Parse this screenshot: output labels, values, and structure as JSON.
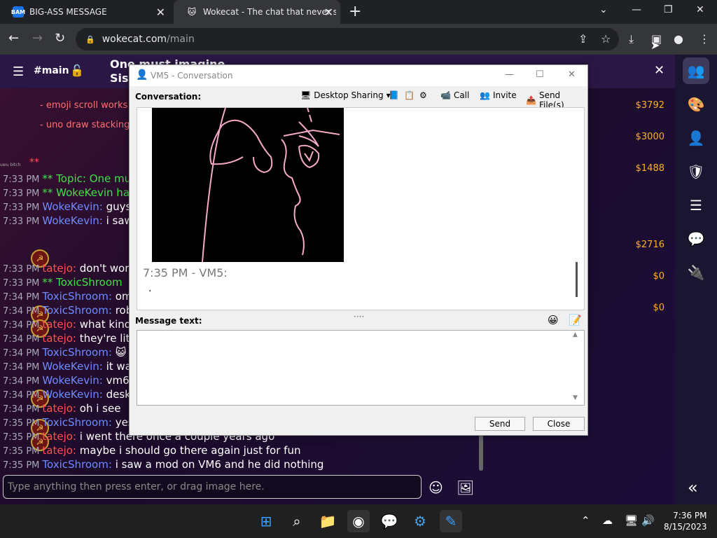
{
  "tabs": [
    {
      "label": "BIG-ASS MESSAGE",
      "icon": "BAM"
    },
    {
      "label": "Wokecat - The chat that never sle",
      "icon": "cat-icon"
    }
  ],
  "address": {
    "domain": "wokecat.com",
    "path": "/main"
  },
  "chat": {
    "channel": "#main",
    "topic": "One must imagine Sisyphus hap",
    "notes": [
      "- emoji scroll works r",
      "- uno draw stacking"
    ],
    "small_label": "uwu bitch",
    "stars": "**",
    "money": [
      "$3792",
      "$3000",
      "$1488",
      "$2716",
      "$0",
      "$0"
    ],
    "messages": [
      {
        "time": "7:33 PM",
        "user": "",
        "text": "** Topic: One mu",
        "style": "green"
      },
      {
        "time": "7:33 PM",
        "user": "",
        "text": "** WokeKevin ha",
        "style": "green"
      },
      {
        "time": "7:33 PM",
        "user": "WokeKevin:",
        "text": "guys",
        "style": "blue"
      },
      {
        "time": "7:33 PM",
        "user": "WokeKevin:",
        "text": "i saw",
        "style": "blue"
      },
      {
        "time": "7:33 PM",
        "user": "tatejo:",
        "text": "don't worr",
        "style": "red"
      },
      {
        "time": "7:33 PM",
        "user": "",
        "text": "** ToxicShroom",
        "style": "green"
      },
      {
        "time": "7:34 PM",
        "user": "ToxicShroom:",
        "text": "om",
        "style": "blue"
      },
      {
        "time": "7:34 PM",
        "user": "ToxicShroom:",
        "text": "rob",
        "style": "blue"
      },
      {
        "time": "7:34 PM",
        "user": "tatejo:",
        "text": "what kind",
        "style": "red"
      },
      {
        "time": "7:34 PM",
        "user": "tatejo:",
        "text": "they're lite",
        "style": "red"
      },
      {
        "time": "7:34 PM",
        "user": "ToxicShroom:",
        "text": "😺",
        "style": "blue"
      },
      {
        "time": "7:34 PM",
        "user": "WokeKevin:",
        "text": "it wa",
        "style": "blue"
      },
      {
        "time": "7:34 PM",
        "user": "WokeKevin:",
        "text": "vm6",
        "style": "blue"
      },
      {
        "time": "7:34 PM",
        "user": "WokeKevin:",
        "text": "desk",
        "style": "blue"
      },
      {
        "time": "7:34 PM",
        "user": "tatejo:",
        "text": "oh i see",
        "style": "red"
      },
      {
        "time": "7:35 PM",
        "user": "ToxicShroom:",
        "text": "yes",
        "style": "blue"
      },
      {
        "time": "7:35 PM",
        "user": "tatejo:",
        "text": "i went there once a couple years ago",
        "style": "red"
      },
      {
        "time": "7:35 PM",
        "user": "tatejo:",
        "text": "maybe i should go there again just for fun",
        "style": "red"
      },
      {
        "time": "7:35 PM",
        "user": "ToxicShroom:",
        "text": "i saw a mod on VM6 and he did nothing",
        "style": "blue"
      }
    ],
    "input_placeholder": "Type anything then press enter, or drag image here."
  },
  "dialog": {
    "title": "VM5 - Conversation",
    "conversation_label": "Conversation:",
    "toolbar": {
      "desktop_sharing": "Desktop Sharing",
      "call": "Call",
      "invite": "Invite",
      "send_files": "Send File(s)"
    },
    "message_time": "7:35 PM - VM5:",
    "message_body": ".",
    "message_label": "Message text:",
    "send": "Send",
    "close": "Close"
  },
  "taskbar": {
    "time": "7:36 PM",
    "date": "8/15/2023"
  }
}
